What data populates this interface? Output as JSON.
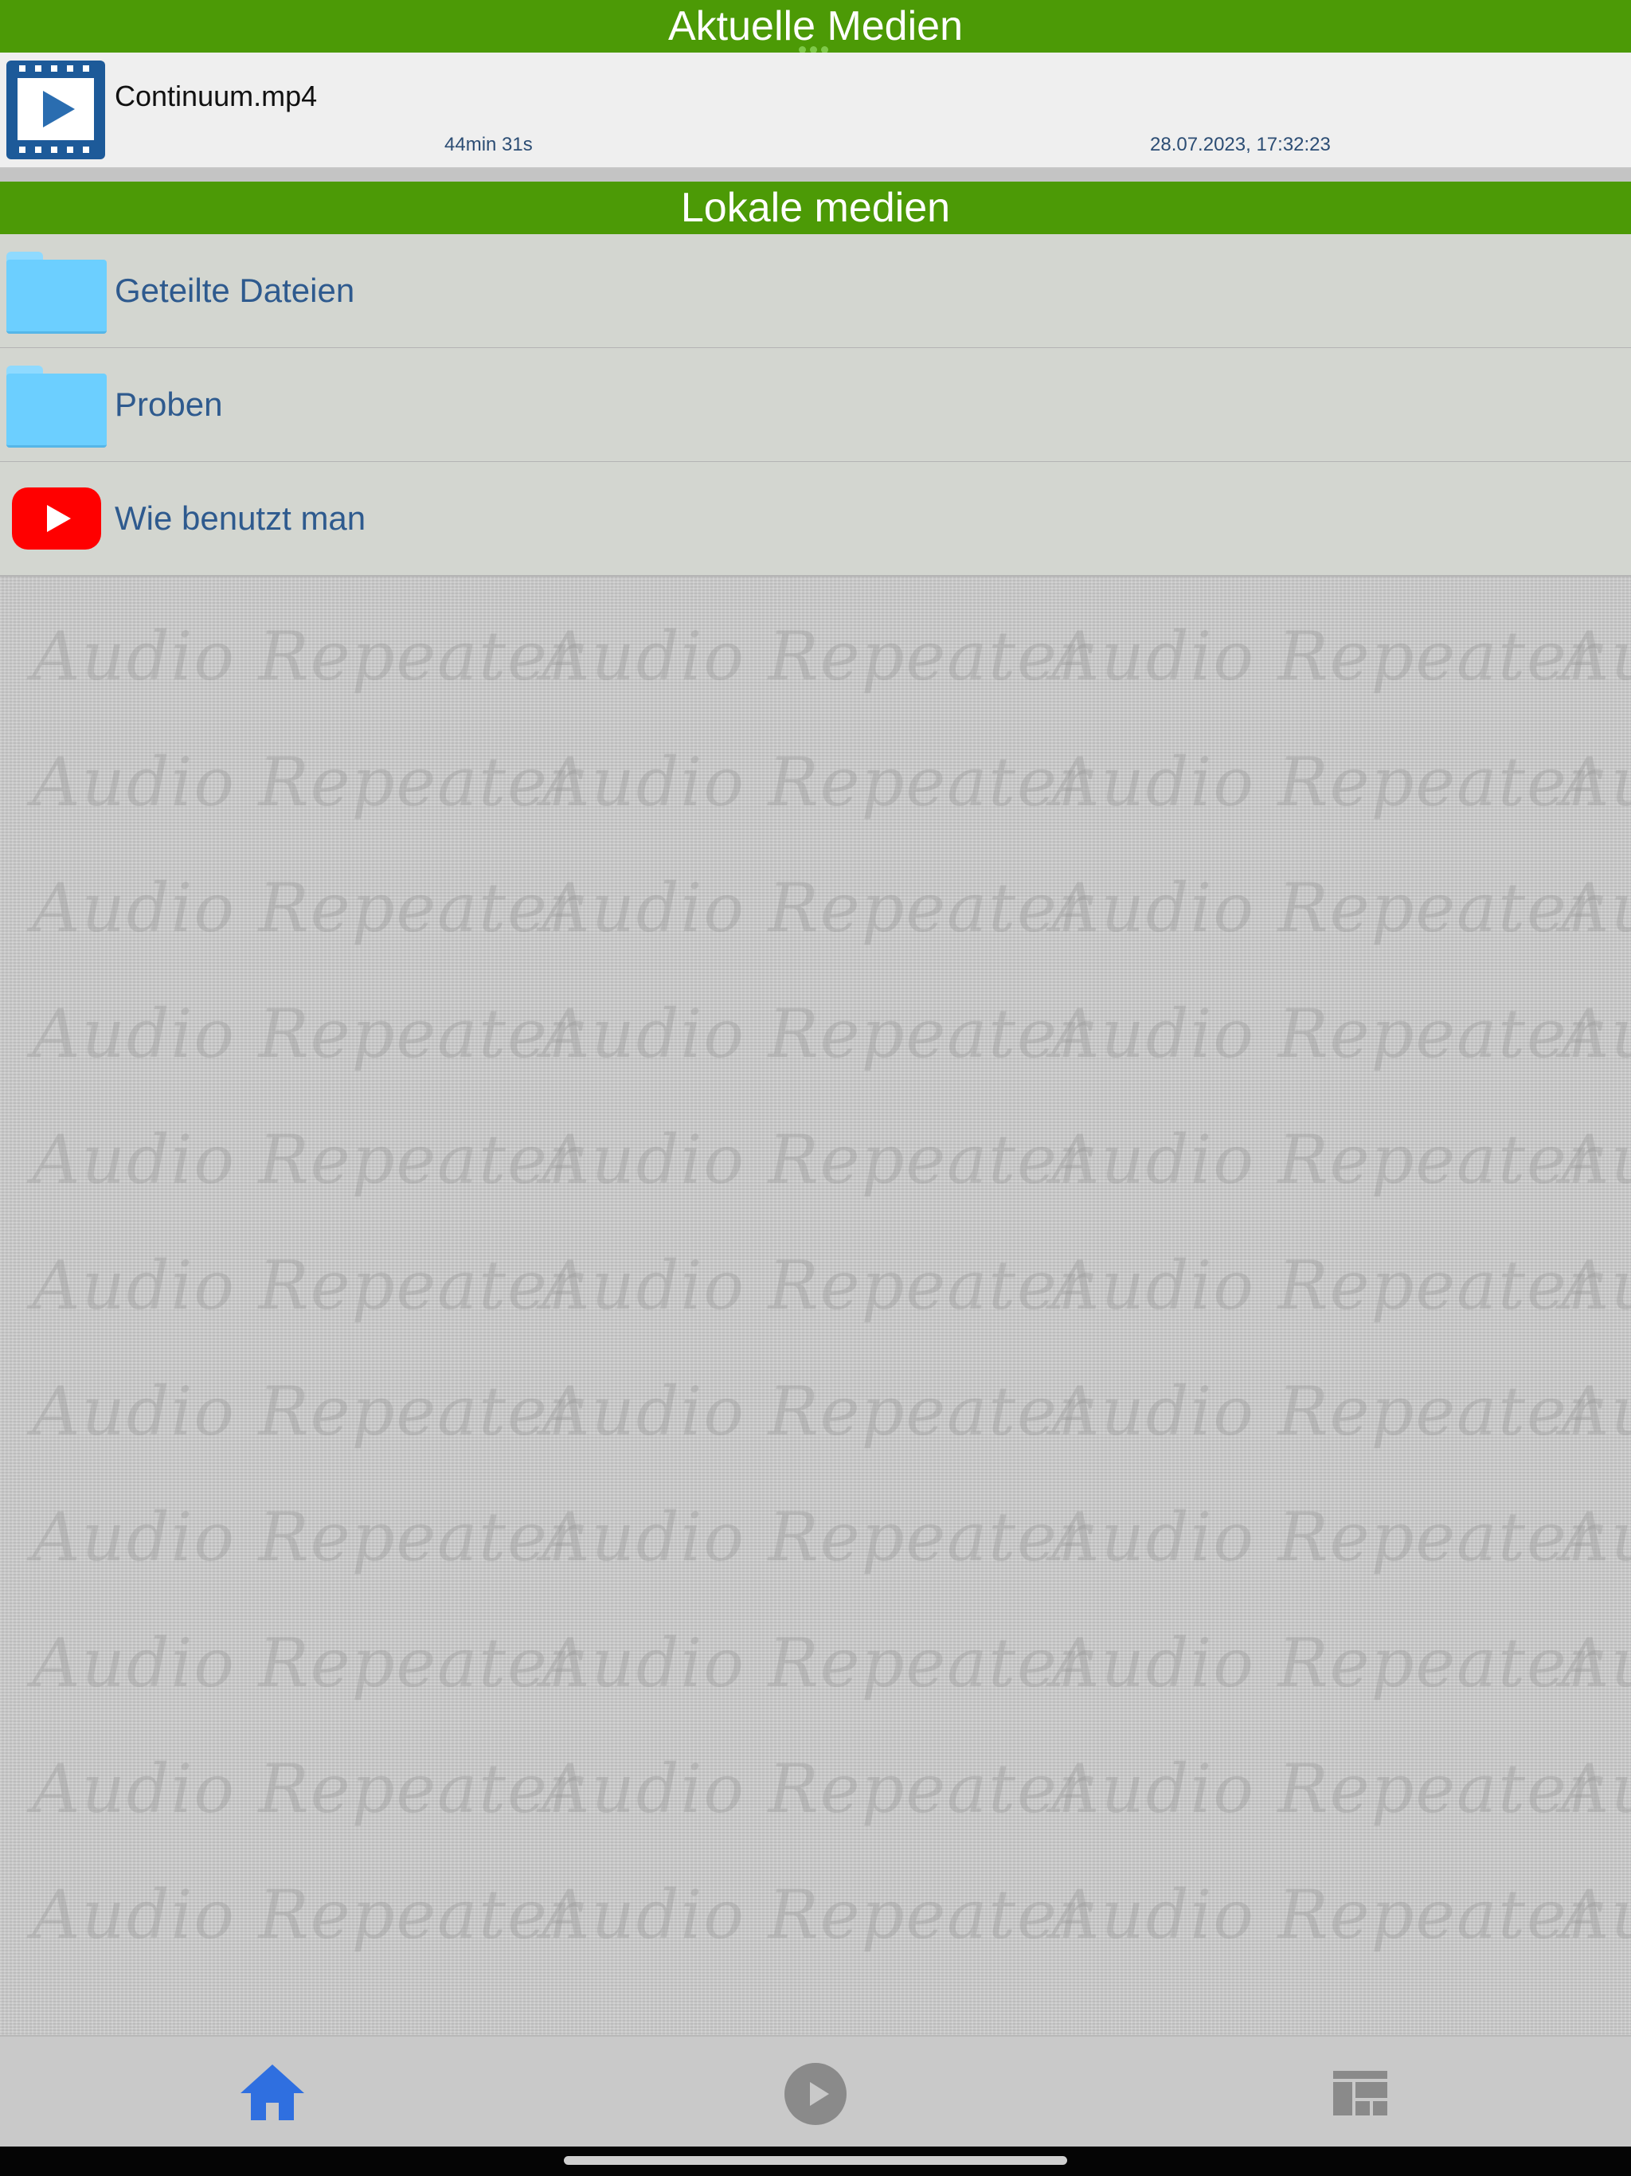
{
  "recent_section": {
    "title": "Aktuelle Medien",
    "item": {
      "name": "Continuum.mp4",
      "duration": "44min 31s",
      "date": "28.07.2023, 17:32:23"
    }
  },
  "local_section": {
    "title": "Lokale medien",
    "items": [
      {
        "label": "Geteilte Dateien",
        "icon": "folder-icon"
      },
      {
        "label": "Proben",
        "icon": "folder-icon"
      },
      {
        "label": "Wie benutzt man",
        "icon": "youtube-icon"
      }
    ]
  },
  "watermark": "Audio Repeater",
  "tab_bar": {
    "tabs": [
      {
        "icon": "home-icon",
        "active": true
      },
      {
        "icon": "play-circle-icon",
        "active": false
      },
      {
        "icon": "grid-layout-icon",
        "active": false
      }
    ]
  },
  "colors": {
    "header_green": "#4c9a06",
    "link_blue": "#2e5a8e",
    "active_tab": "#2f6fe0",
    "inactive_tab": "#8a8a8a",
    "youtube_red": "#ff0000",
    "folder_blue": "#6ccfff"
  }
}
